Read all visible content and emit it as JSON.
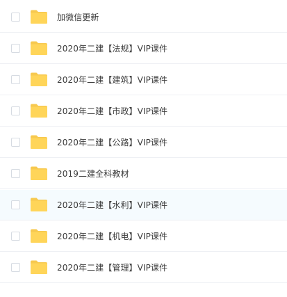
{
  "file_list": {
    "rows": [
      {
        "name": "加微信更新",
        "icon": "folder-icon",
        "hovered": false
      },
      {
        "name": "2020年二建【法规】VIP课件",
        "icon": "folder-icon",
        "hovered": false
      },
      {
        "name": "2020年二建【建筑】VIP课件",
        "icon": "folder-icon",
        "hovered": false
      },
      {
        "name": "2020年二建【市政】VIP课件",
        "icon": "folder-icon",
        "hovered": false
      },
      {
        "name": "2020年二建【公路】VIP课件",
        "icon": "folder-icon",
        "hovered": false
      },
      {
        "name": "2019二建全科教材",
        "icon": "folder-icon",
        "hovered": false
      },
      {
        "name": "2020年二建【水利】VIP课件",
        "icon": "folder-icon",
        "hovered": true
      },
      {
        "name": "2020年二建【机电】VIP课件",
        "icon": "folder-icon",
        "hovered": false
      },
      {
        "name": "2020年二建【管理】VIP课件",
        "icon": "folder-icon",
        "hovered": false
      }
    ]
  },
  "colors": {
    "folder": "#ffd559",
    "folder_tab": "#f7c94f",
    "row_hover": "#f5fbfe",
    "divider": "#eef0f4",
    "checkbox_border": "#d6dbe2",
    "text": "#3b3b3b"
  }
}
